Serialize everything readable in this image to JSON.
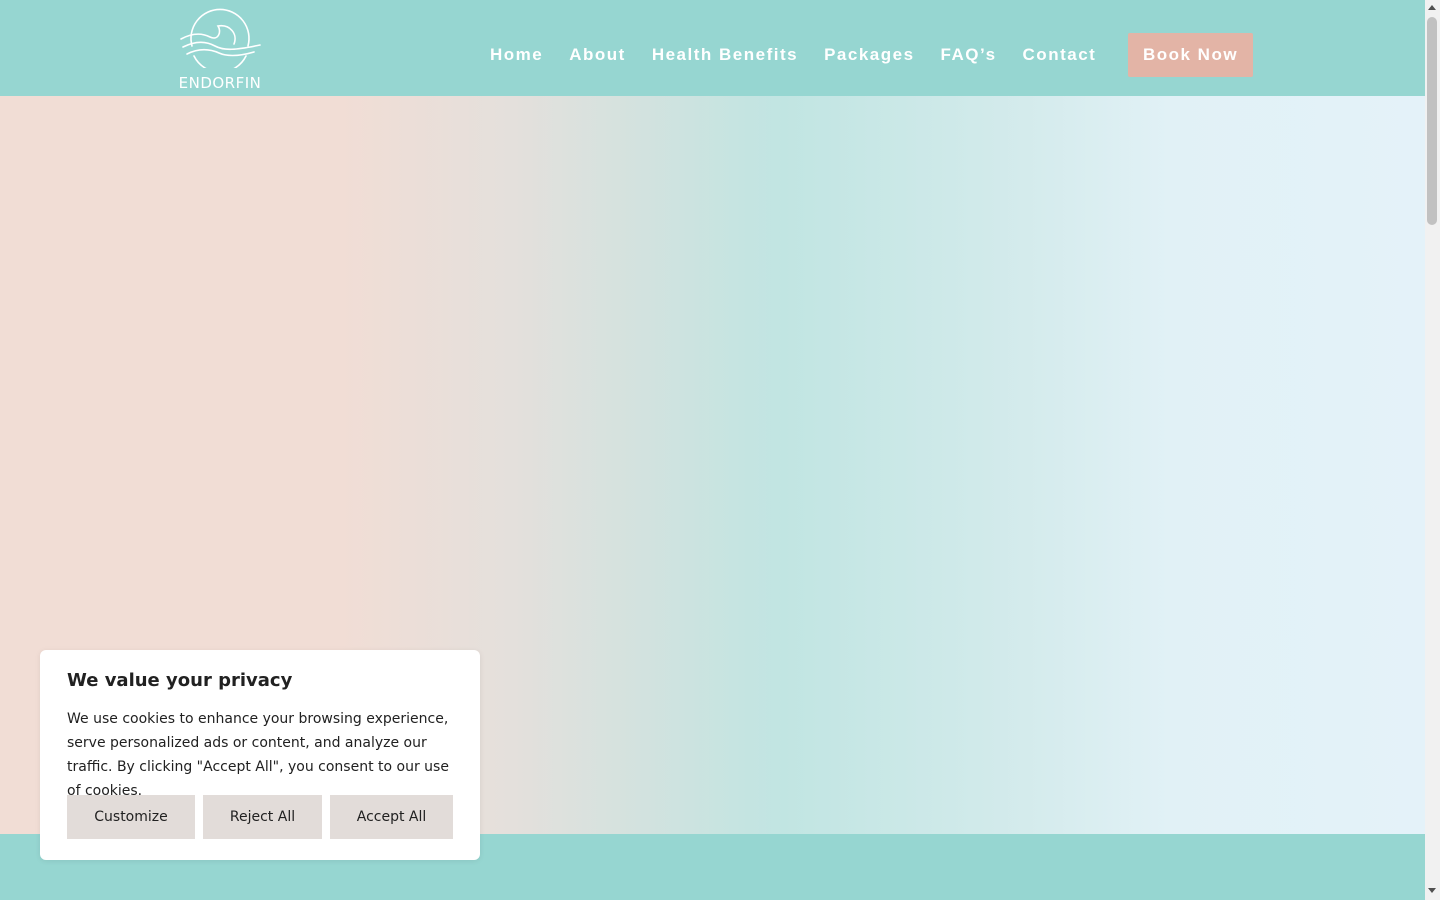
{
  "header": {
    "logo_text": "ENDORFIN",
    "nav": [
      "Home",
      "About",
      "Health Benefits",
      "Packages",
      "FAQ’s",
      "Contact"
    ],
    "book_button": "Book Now",
    "colors": {
      "header_bg": "#96d6d1",
      "book_bg": "#e3b4a6"
    }
  },
  "cookie_banner": {
    "title": "We value your privacy",
    "text": "We use cookies to enhance your browsing experience, serve personalized ads or content, and analyze our traffic. By clicking \"Accept All\", you consent to our use of cookies.",
    "buttons": {
      "customize": "Customize",
      "reject": "Reject All",
      "accept": "Accept All"
    }
  }
}
